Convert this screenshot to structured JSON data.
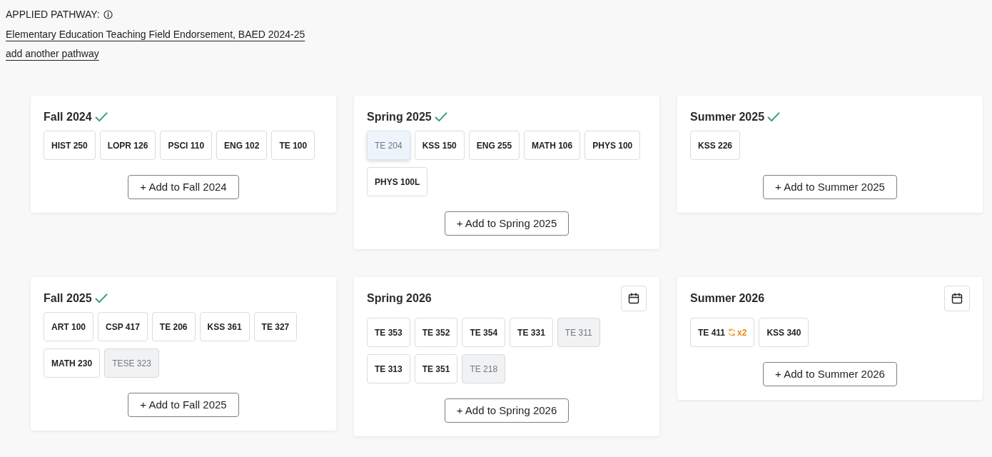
{
  "pathway": {
    "label": "APPLIED PATHWAY:",
    "pathway_link": "Elementary Education Teaching Field Endorsement, BAED 2024-25",
    "add_link": "add another pathway"
  },
  "terms": [
    {
      "title": "Fall 2024",
      "completed": true,
      "calendar": false,
      "courses": [
        {
          "code": "HIST 250",
          "highlighted": false,
          "greyed": false
        },
        {
          "code": "LOPR 126",
          "highlighted": false,
          "greyed": false
        },
        {
          "code": "PSCI 110",
          "highlighted": false,
          "greyed": false
        },
        {
          "code": "ENG 102",
          "highlighted": false,
          "greyed": false
        },
        {
          "code": "TE 100",
          "highlighted": false,
          "greyed": false
        }
      ],
      "add_button": "+ Add to Fall 2024"
    },
    {
      "title": "Spring 2025",
      "completed": true,
      "calendar": false,
      "courses": [
        {
          "code": "TE 204",
          "highlighted": true,
          "greyed": false
        },
        {
          "code": "KSS 150",
          "highlighted": false,
          "greyed": false
        },
        {
          "code": "ENG 255",
          "highlighted": false,
          "greyed": false
        },
        {
          "code": "MATH 106",
          "highlighted": false,
          "greyed": false
        },
        {
          "code": "PHYS 100",
          "highlighted": false,
          "greyed": false
        },
        {
          "code": "PHYS 100L",
          "highlighted": false,
          "greyed": false
        }
      ],
      "add_button": "+ Add to Spring 2025"
    },
    {
      "title": "Summer 2025",
      "completed": true,
      "calendar": false,
      "courses": [
        {
          "code": "KSS 226",
          "highlighted": false,
          "greyed": false
        }
      ],
      "add_button": "+ Add to Summer 2025"
    },
    {
      "title": "Fall 2025",
      "completed": true,
      "calendar": false,
      "courses": [
        {
          "code": "ART 100",
          "highlighted": false,
          "greyed": false
        },
        {
          "code": "CSP 417",
          "highlighted": false,
          "greyed": false
        },
        {
          "code": "TE 206",
          "highlighted": false,
          "greyed": false
        },
        {
          "code": "KSS 361",
          "highlighted": false,
          "greyed": false
        },
        {
          "code": "TE 327",
          "highlighted": false,
          "greyed": false
        },
        {
          "code": "MATH 230",
          "highlighted": false,
          "greyed": false
        },
        {
          "code": "TESE 323",
          "highlighted": false,
          "greyed": true
        }
      ],
      "add_button": "+ Add to Fall 2025"
    },
    {
      "title": "Spring 2026",
      "completed": false,
      "calendar": true,
      "courses": [
        {
          "code": "TE 353",
          "highlighted": false,
          "greyed": false
        },
        {
          "code": "TE 352",
          "highlighted": false,
          "greyed": false
        },
        {
          "code": "TE 354",
          "highlighted": false,
          "greyed": false
        },
        {
          "code": "TE 331",
          "highlighted": false,
          "greyed": false
        },
        {
          "code": "TE 311",
          "highlighted": false,
          "greyed": true
        },
        {
          "code": "TE 313",
          "highlighted": false,
          "greyed": false
        },
        {
          "code": "TE 351",
          "highlighted": false,
          "greyed": false
        },
        {
          "code": "TE 218",
          "highlighted": false,
          "greyed": true
        }
      ],
      "add_button": "+ Add to Spring 2026"
    },
    {
      "title": "Summer 2026",
      "completed": false,
      "calendar": true,
      "courses": [
        {
          "code": "TE 411",
          "highlighted": false,
          "greyed": false,
          "repeat": "x2"
        },
        {
          "code": "KSS 340",
          "highlighted": false,
          "greyed": false
        }
      ],
      "add_button": "+ Add to Summer 2026"
    }
  ]
}
